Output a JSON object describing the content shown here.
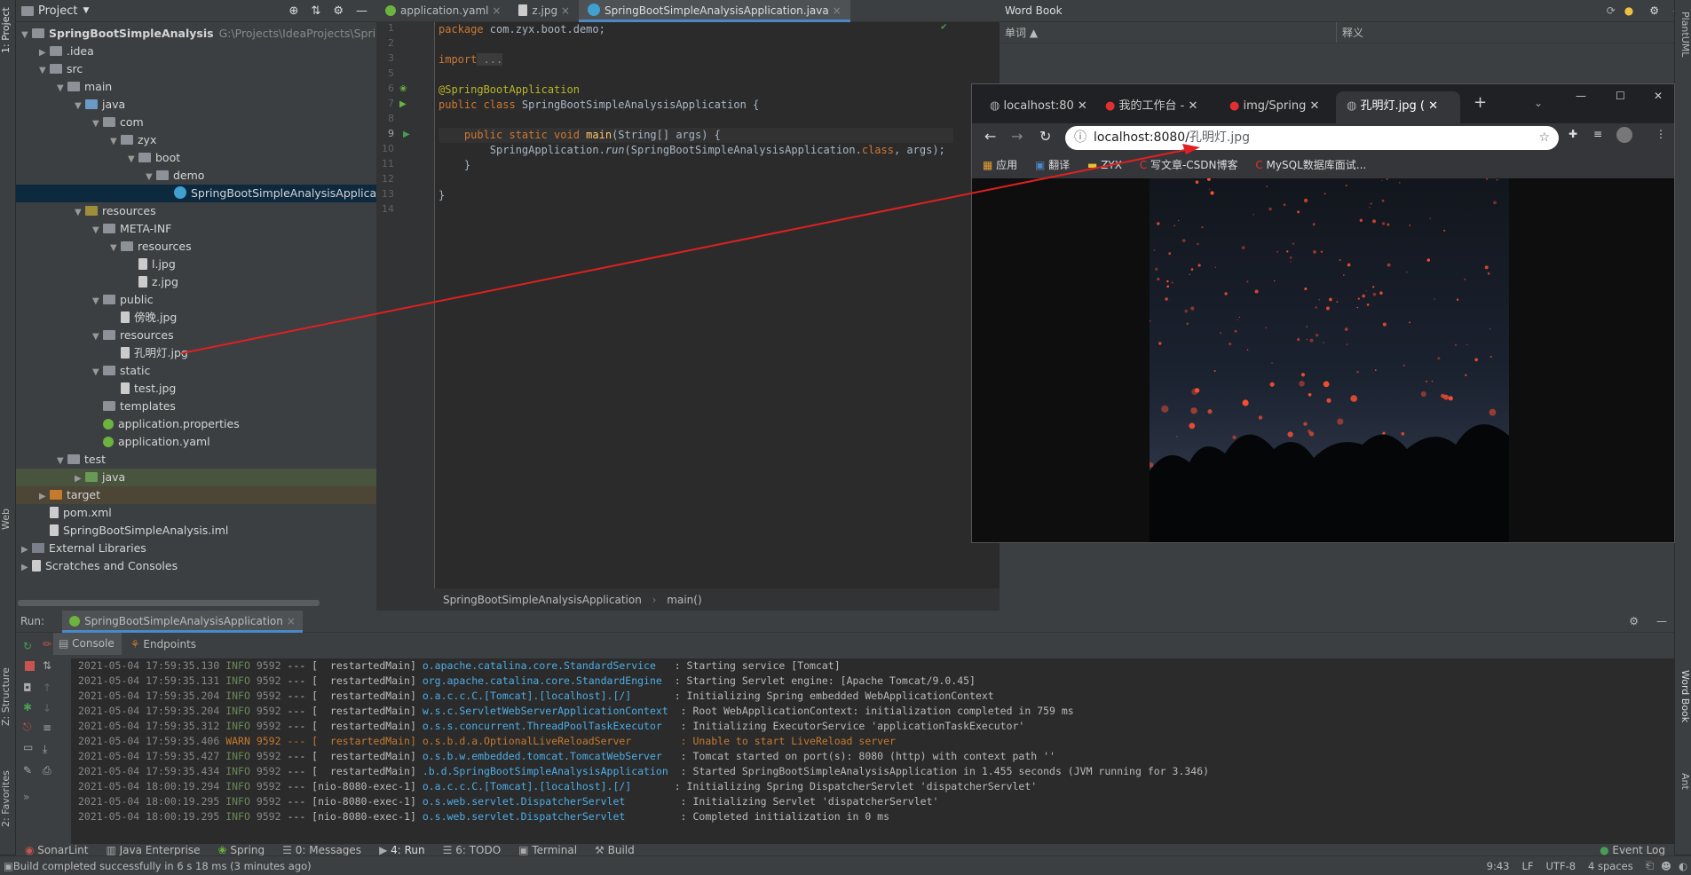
{
  "left_strip": {
    "project_tab": "1: Project",
    "structure_tab": "Z: Structure",
    "favorites_tab": "2: Favorites",
    "web_tab": "Web"
  },
  "project_panel": {
    "title": "Project",
    "tree": [
      {
        "label": "SpringBootSimpleAnalysis",
        "path": "G:\\Projects\\IdeaProjects\\SpringBootS",
        "kind": "module",
        "depth": 0,
        "expanded": true
      },
      {
        "label": ".idea",
        "kind": "folder",
        "depth": 1,
        "expanded": false
      },
      {
        "label": "src",
        "kind": "folder",
        "depth": 1,
        "expanded": true
      },
      {
        "label": "main",
        "kind": "folder",
        "depth": 2,
        "expanded": true
      },
      {
        "label": "java",
        "kind": "folder-src",
        "depth": 3,
        "expanded": true
      },
      {
        "label": "com",
        "kind": "folder",
        "depth": 4,
        "expanded": true
      },
      {
        "label": "zyx",
        "kind": "folder",
        "depth": 5,
        "expanded": true
      },
      {
        "label": "boot",
        "kind": "folder",
        "depth": 6,
        "expanded": true
      },
      {
        "label": "demo",
        "kind": "folder",
        "depth": 7,
        "expanded": true
      },
      {
        "label": "SpringBootSimpleAnalysisApplication",
        "kind": "java",
        "depth": 8,
        "selected": true
      },
      {
        "label": "resources",
        "kind": "folder-res",
        "depth": 3,
        "expanded": true
      },
      {
        "label": "META-INF",
        "kind": "folder",
        "depth": 4,
        "expanded": true
      },
      {
        "label": "resources",
        "kind": "folder",
        "depth": 5,
        "expanded": true
      },
      {
        "label": "l.jpg",
        "kind": "file",
        "depth": 6
      },
      {
        "label": "z.jpg",
        "kind": "file",
        "depth": 6
      },
      {
        "label": "public",
        "kind": "folder",
        "depth": 4,
        "expanded": true
      },
      {
        "label": "傍晚.jpg",
        "kind": "file",
        "depth": 5
      },
      {
        "label": "resources",
        "kind": "folder",
        "depth": 4,
        "expanded": true
      },
      {
        "label": "孔明灯.jpg",
        "kind": "file",
        "depth": 5
      },
      {
        "label": "static",
        "kind": "folder",
        "depth": 4,
        "expanded": true
      },
      {
        "label": "test.jpg",
        "kind": "file",
        "depth": 5
      },
      {
        "label": "templates",
        "kind": "folder",
        "depth": 4
      },
      {
        "label": "application.properties",
        "kind": "spring",
        "depth": 4
      },
      {
        "label": "application.yaml",
        "kind": "spring",
        "depth": 4
      },
      {
        "label": "test",
        "kind": "folder",
        "depth": 2,
        "expanded": true
      },
      {
        "label": "java",
        "kind": "folder-test",
        "depth": 3,
        "expanded": false
      },
      {
        "label": "target",
        "kind": "folder-orange",
        "depth": 1,
        "expanded": false
      },
      {
        "label": "pom.xml",
        "kind": "maven",
        "depth": 1
      },
      {
        "label": "SpringBootSimpleAnalysis.iml",
        "kind": "file",
        "depth": 1
      },
      {
        "label": "External Libraries",
        "kind": "lib",
        "depth": 0,
        "expanded": false
      },
      {
        "label": "Scratches and Consoles",
        "kind": "scratch",
        "depth": 0,
        "expanded": false
      }
    ]
  },
  "editor": {
    "tabs": [
      {
        "label": "application.yaml",
        "active": false
      },
      {
        "label": "z.jpg",
        "active": false
      },
      {
        "label": "SpringBootSimpleAnalysisApplication.java",
        "active": true
      }
    ],
    "line_numbers": [
      "1",
      "2",
      "3",
      "5",
      "6",
      "7",
      "8",
      "9",
      "10",
      "11",
      "12",
      "13",
      "14"
    ],
    "code": {
      "l1_kw": "package",
      "l1_rest": " com.zyx.boot.demo;",
      "l3_kw": "import",
      "l3_rest": " ...",
      "l6_ann": "@SpringBootApplication",
      "l7_kw": "public class",
      "l7_rest": " SpringBootSimpleAnalysisApplication {",
      "l9_kw": "    public static void",
      "l9_fn": " main",
      "l9_rest": "(String[] args) {",
      "l10_a": "        SpringApplication.",
      "l10_it": "run",
      "l10_b": "(SpringBootSimpleAnalysisApplication.",
      "l10_kw": "class",
      "l10_c": ", args);",
      "l11": "    }",
      "l13": "}"
    },
    "breadcrumb": {
      "a": "SpringBootSimpleAnalysisApplication",
      "sep": "›",
      "b": "main()"
    }
  },
  "word_book": {
    "title": "Word Book",
    "col_word": "单词 ▲",
    "col_meaning": "释义"
  },
  "browser": {
    "tabs": [
      {
        "label": "localhost:80",
        "active": false
      },
      {
        "label": "我的工作台 -",
        "active": false
      },
      {
        "label": "img/Spring",
        "active": false
      },
      {
        "label": "孔明灯.jpg (",
        "active": true
      }
    ],
    "url_host": "localhost:8080/",
    "url_path": "孔明灯.jpg",
    "bookmarks": [
      "应用",
      "翻译",
      "ZYX",
      "写文章-CSDN博客",
      "MySQL数据库面试..."
    ]
  },
  "run_panel": {
    "run_label": "Run:",
    "run_config": "SpringBootSimpleAnalysisApplication",
    "subtabs": [
      "Console",
      "Endpoints"
    ],
    "logs": [
      {
        "date": "2021-05-04 17:59:35.130",
        "level": "INFO",
        "pid": "9592",
        "thread": "--- [  restartedMain]",
        "logger": "o.apache.catalina.core.StandardService  ",
        "msg": ": Starting service [Tomcat]"
      },
      {
        "date": "2021-05-04 17:59:35.131",
        "level": "INFO",
        "pid": "9592",
        "thread": "--- [  restartedMain]",
        "logger": "org.apache.catalina.core.StandardEngine ",
        "msg": ": Starting Servlet engine: [Apache Tomcat/9.0.45]"
      },
      {
        "date": "2021-05-04 17:59:35.204",
        "level": "INFO",
        "pid": "9592",
        "thread": "--- [  restartedMain]",
        "logger": "o.a.c.c.C.[Tomcat].[localhost].[/]      ",
        "msg": ": Initializing Spring embedded WebApplicationContext"
      },
      {
        "date": "2021-05-04 17:59:35.204",
        "level": "INFO",
        "pid": "9592",
        "thread": "--- [  restartedMain]",
        "logger": "w.s.c.ServletWebServerApplicationContext ",
        "msg": ": Root WebApplicationContext: initialization completed in 759 ms"
      },
      {
        "date": "2021-05-04 17:59:35.312",
        "level": "INFO",
        "pid": "9592",
        "thread": "--- [  restartedMain]",
        "logger": "o.s.s.concurrent.ThreadPoolTaskExecutor  ",
        "msg": ": Initializing ExecutorService 'applicationTaskExecutor'"
      },
      {
        "date": "2021-05-04 17:59:35.406",
        "level": "WARN",
        "pid": "9592",
        "thread": "--- [  restartedMain]",
        "logger": "o.s.b.d.a.OptionalLiveReloadServer       ",
        "msg": ": Unable to start LiveReload server"
      },
      {
        "date": "2021-05-04 17:59:35.427",
        "level": "INFO",
        "pid": "9592",
        "thread": "--- [  restartedMain]",
        "logger": "o.s.b.w.embedded.tomcat.TomcatWebServer  ",
        "msg": ": Tomcat started on port(s): 8080 (http) with context path ''"
      },
      {
        "date": "2021-05-04 17:59:35.434",
        "level": "INFO",
        "pid": "9592",
        "thread": "--- [  restartedMain]",
        "logger": ".b.d.SpringBootSimpleAnalysisApplication ",
        "msg": ": Started SpringBootSimpleAnalysisApplication in 1.455 seconds (JVM running for 3.346)"
      },
      {
        "date": "2021-05-04 18:00:19.294",
        "level": "INFO",
        "pid": "9592",
        "thread": "--- [nio-8080-exec-1]",
        "logger": "o.a.c.c.C.[Tomcat].[localhost].[/]      ",
        "msg": ": Initializing Spring DispatcherServlet 'dispatcherServlet'"
      },
      {
        "date": "2021-05-04 18:00:19.295",
        "level": "INFO",
        "pid": "9592",
        "thread": "--- [nio-8080-exec-1]",
        "logger": "o.s.web.servlet.DispatcherServlet        ",
        "msg": ": Initializing Servlet 'dispatcherServlet'"
      },
      {
        "date": "2021-05-04 18:00:19.295",
        "level": "INFO",
        "pid": "9592",
        "thread": "--- [nio-8080-exec-1]",
        "logger": "o.s.web.servlet.DispatcherServlet        ",
        "msg": ": Completed initialization in 0 ms"
      }
    ]
  },
  "bottom_tabs": [
    "SonarLint",
    "Java Enterprise",
    "Spring",
    "0: Messages",
    "4: Run",
    "6: TODO",
    "Terminal",
    "Build"
  ],
  "event_log": "Event Log",
  "status": {
    "message": "Build completed successfully in 6 s 18 ms (3 minutes ago)",
    "time": "9:43",
    "line_sep": "LF",
    "encoding": "UTF-8",
    "indent": "4 spaces"
  },
  "right_strip": {
    "word_book_tab": "Word Book",
    "ant_tab": "Ant",
    "plantuml_tab": "PlantUML"
  },
  "colors": {
    "arrow": "#e02020",
    "selection": "#0d293e",
    "accent": "#4a88c7"
  }
}
